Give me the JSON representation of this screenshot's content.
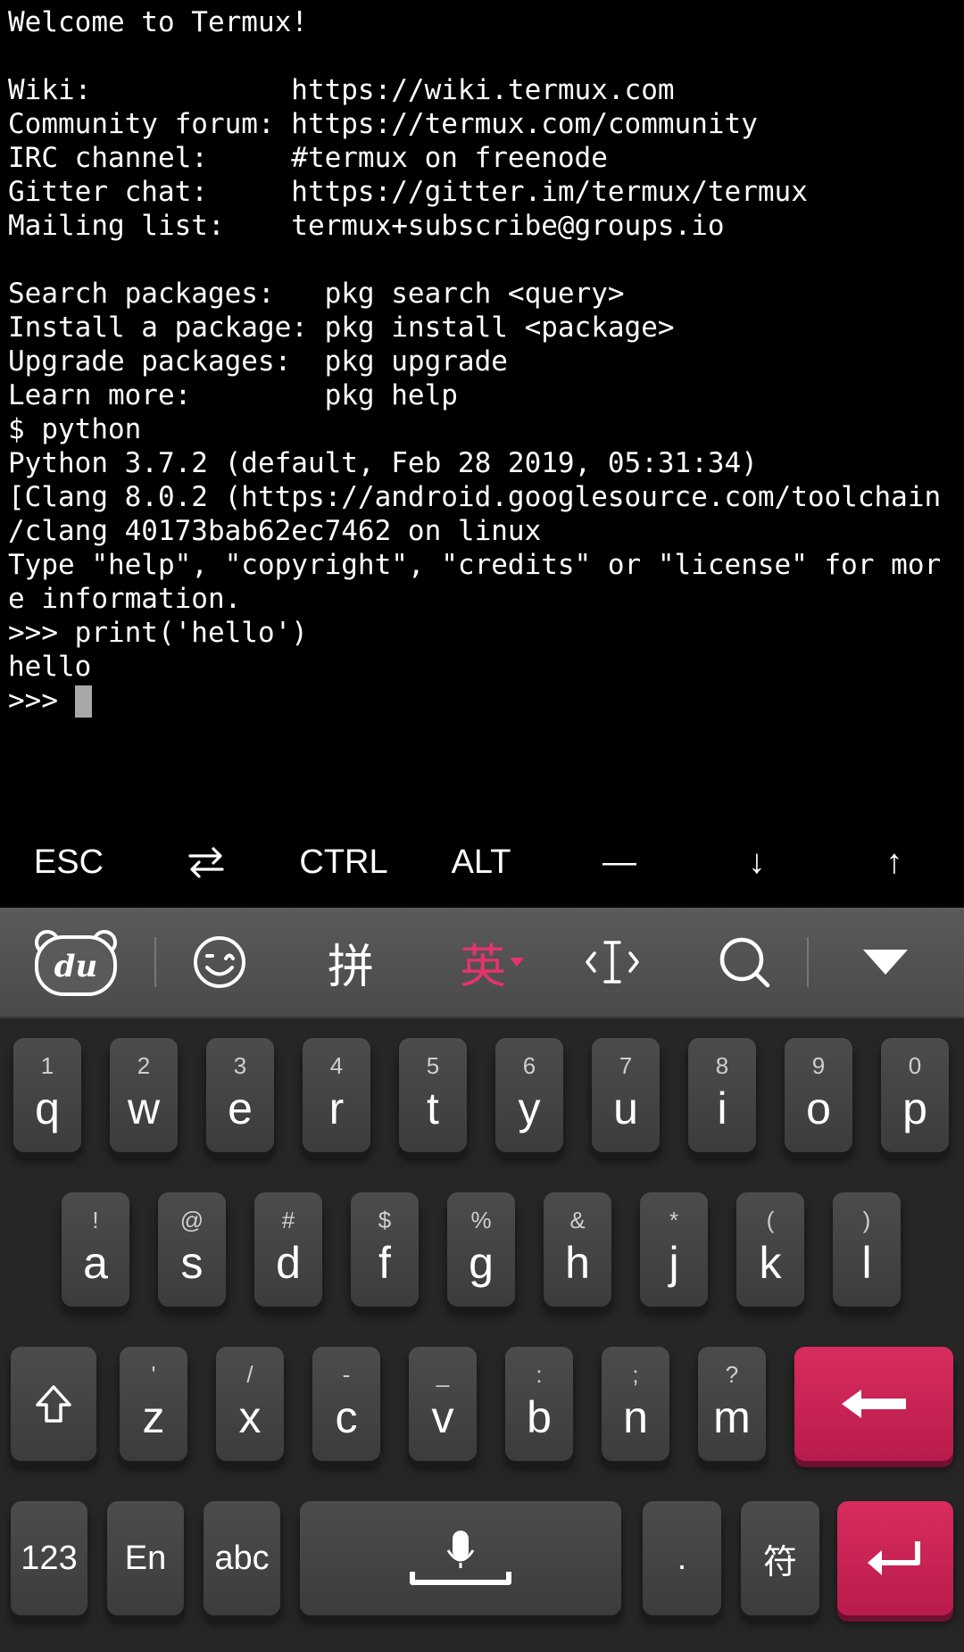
{
  "terminal": {
    "lines": [
      "Welcome to Termux!",
      "",
      "Wiki:            https://wiki.termux.com",
      "Community forum: https://termux.com/community",
      "IRC channel:     #termux on freenode",
      "Gitter chat:     https://gitter.im/termux/termux",
      "Mailing list:    termux+subscribe@groups.io",
      "",
      "Search packages:   pkg search <query>",
      "Install a package: pkg install <package>",
      "Upgrade packages:  pkg upgrade",
      "Learn more:        pkg help",
      "$ python",
      "Python 3.7.2 (default, Feb 28 2019, 05:31:34)",
      "[Clang 8.0.2 (https://android.googlesource.com/toolchain",
      "/clang 40173bab62ec7462 on linux",
      "Type \"help\", \"copyright\", \"credits\" or \"license\" for mor",
      "e information.",
      ">>> print('hello')",
      "hello"
    ],
    "prompt": ">>> "
  },
  "extra_keys": [
    "ESC",
    "⇄",
    "CTRL",
    "ALT",
    "—",
    "↓",
    "↑"
  ],
  "ime_toolbar": {
    "logo_icon": "du-bear-logo-icon",
    "emoji_icon": "emoji-wink-icon",
    "pinyin_label": "拼",
    "english_label": "英",
    "cursor_icon": "text-cursor-icon",
    "search_icon": "search-icon",
    "collapse_icon": "collapse-triangle-icon",
    "accent_color": "#e5336b"
  },
  "keyboard": {
    "row1": [
      {
        "hint": "1",
        "key": "q"
      },
      {
        "hint": "2",
        "key": "w"
      },
      {
        "hint": "3",
        "key": "e"
      },
      {
        "hint": "4",
        "key": "r"
      },
      {
        "hint": "5",
        "key": "t"
      },
      {
        "hint": "6",
        "key": "y"
      },
      {
        "hint": "7",
        "key": "u"
      },
      {
        "hint": "8",
        "key": "i"
      },
      {
        "hint": "9",
        "key": "o"
      },
      {
        "hint": "0",
        "key": "p"
      }
    ],
    "row2": [
      {
        "hint": "!",
        "key": "a"
      },
      {
        "hint": "@",
        "key": "s"
      },
      {
        "hint": "#",
        "key": "d"
      },
      {
        "hint": "$",
        "key": "f"
      },
      {
        "hint": "%",
        "key": "g"
      },
      {
        "hint": "&",
        "key": "h"
      },
      {
        "hint": "*",
        "key": "j"
      },
      {
        "hint": "(",
        "key": "k"
      },
      {
        "hint": ")",
        "key": "l"
      }
    ],
    "row3": [
      {
        "hint": "'",
        "key": "z"
      },
      {
        "hint": "/",
        "key": "x"
      },
      {
        "hint": "-",
        "key": "c"
      },
      {
        "hint": "_",
        "key": "v"
      },
      {
        "hint": ":",
        "key": "b"
      },
      {
        "hint": ";",
        "key": "n"
      },
      {
        "hint": "?",
        "key": "m"
      }
    ],
    "shift_icon": "shift-arrow-icon",
    "backspace_icon": "backspace-arrow-icon",
    "row4": {
      "num_label": "123",
      "lang_label": "En",
      "abc_label": "abc",
      "mic_icon": "microphone-space-icon",
      "period_label": ".",
      "symbol_label": "符",
      "enter_icon": "enter-return-icon"
    },
    "accent_color": "#c8215a"
  }
}
